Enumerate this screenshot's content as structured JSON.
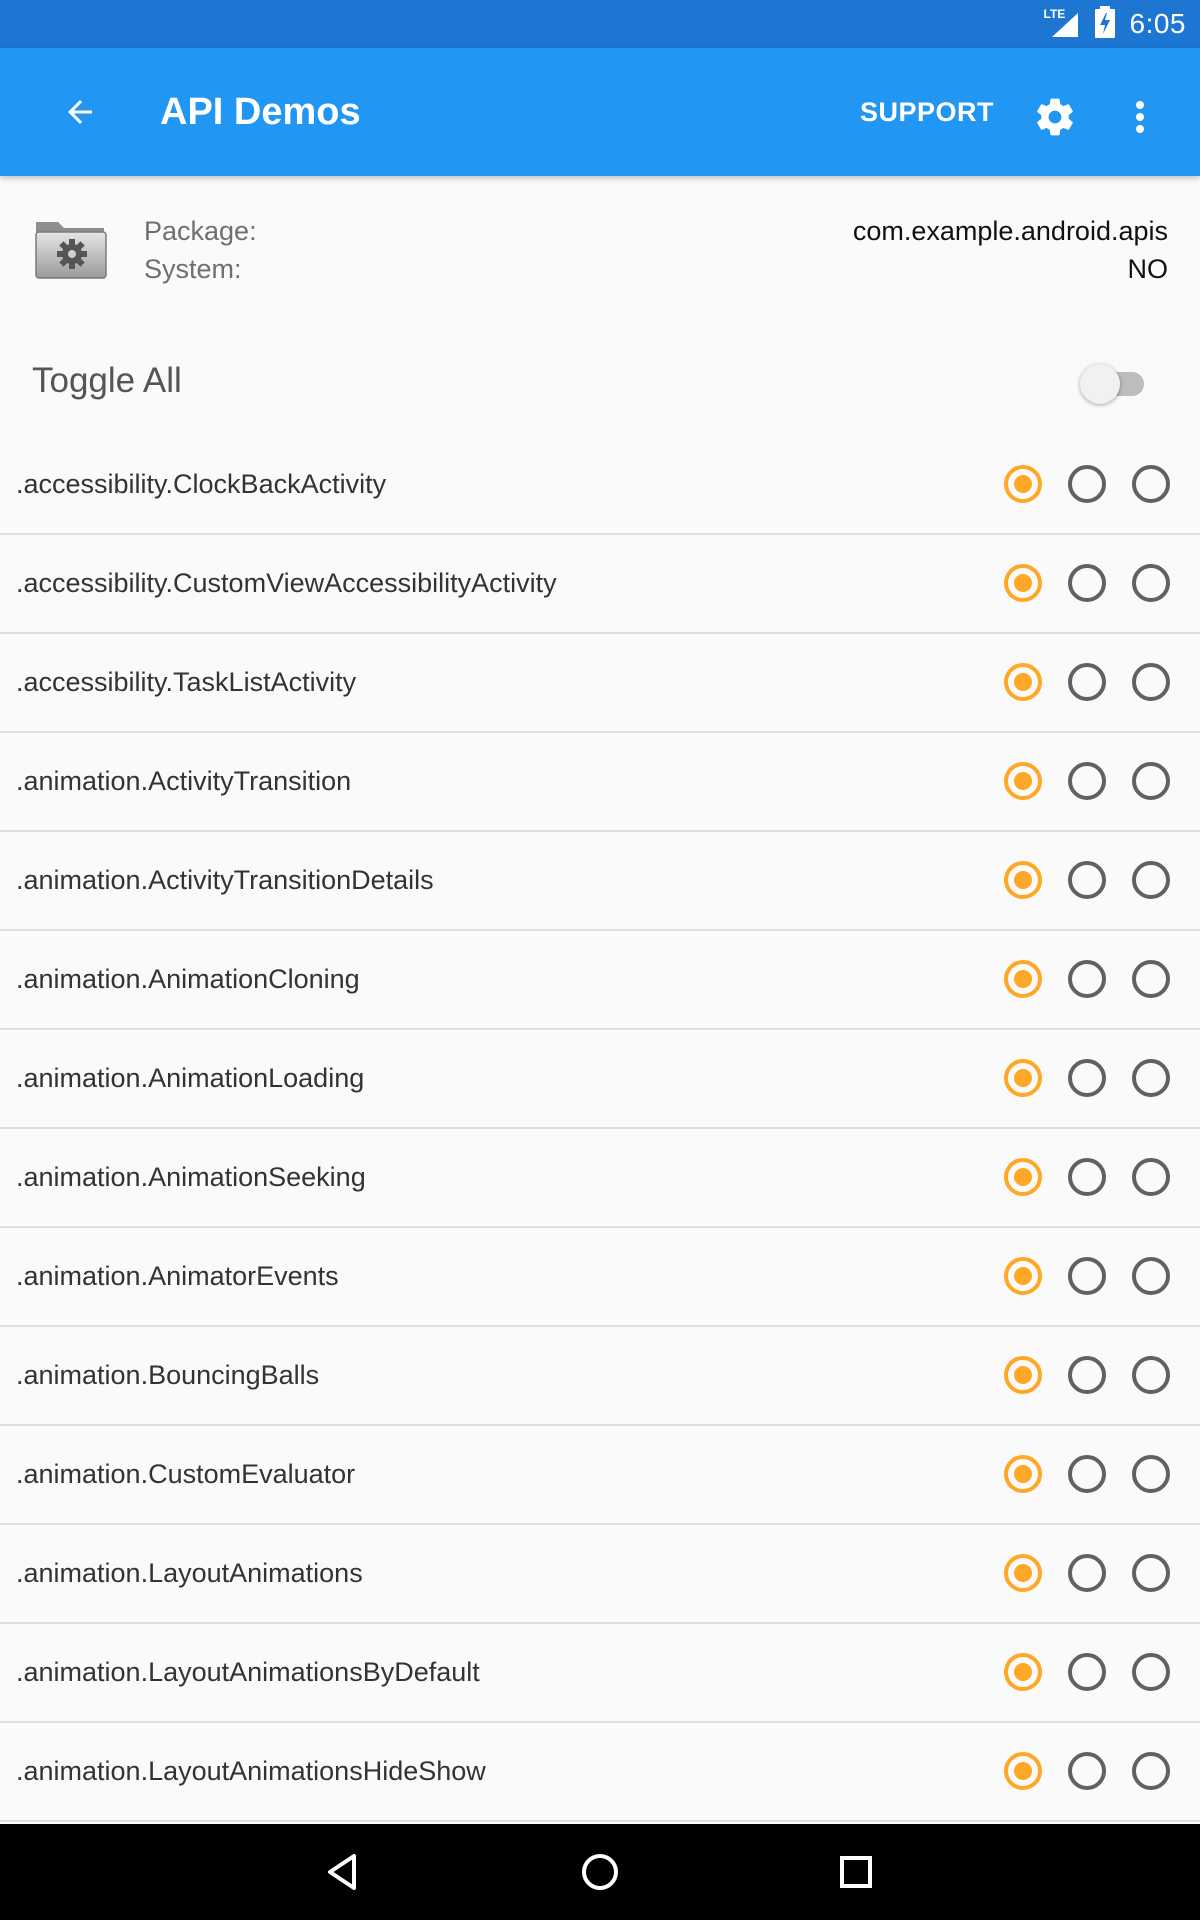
{
  "status_bar": {
    "network_label": "LTE",
    "time": "6:05"
  },
  "toolbar": {
    "title": "API Demos",
    "support_label": "SUPPORT",
    "back_icon": "arrow-back-icon",
    "settings_icon": "gear-icon",
    "overflow_icon": "more-vert-icon",
    "background_color": "#2196f3"
  },
  "info": {
    "package_label": "Package:",
    "package_value": "com.example.android.apis",
    "system_label": "System:",
    "system_value": "NO"
  },
  "toggle_all": {
    "label": "Toggle All",
    "checked": false
  },
  "accent_color": "#ffa726",
  "activities": [
    {
      "name": ".accessibility.ClockBackActivity",
      "selected": 1
    },
    {
      "name": ".accessibility.CustomViewAccessibilityActivity",
      "selected": 1
    },
    {
      "name": ".accessibility.TaskListActivity",
      "selected": 1
    },
    {
      "name": ".animation.ActivityTransition",
      "selected": 1
    },
    {
      "name": ".animation.ActivityTransitionDetails",
      "selected": 1
    },
    {
      "name": ".animation.AnimationCloning",
      "selected": 1
    },
    {
      "name": ".animation.AnimationLoading",
      "selected": 1
    },
    {
      "name": ".animation.AnimationSeeking",
      "selected": 1
    },
    {
      "name": ".animation.AnimatorEvents",
      "selected": 1
    },
    {
      "name": ".animation.BouncingBalls",
      "selected": 1
    },
    {
      "name": ".animation.CustomEvaluator",
      "selected": 1
    },
    {
      "name": ".animation.LayoutAnimations",
      "selected": 1
    },
    {
      "name": ".animation.LayoutAnimationsByDefault",
      "selected": 1
    },
    {
      "name": ".animation.LayoutAnimationsHideShow",
      "selected": 1
    }
  ]
}
